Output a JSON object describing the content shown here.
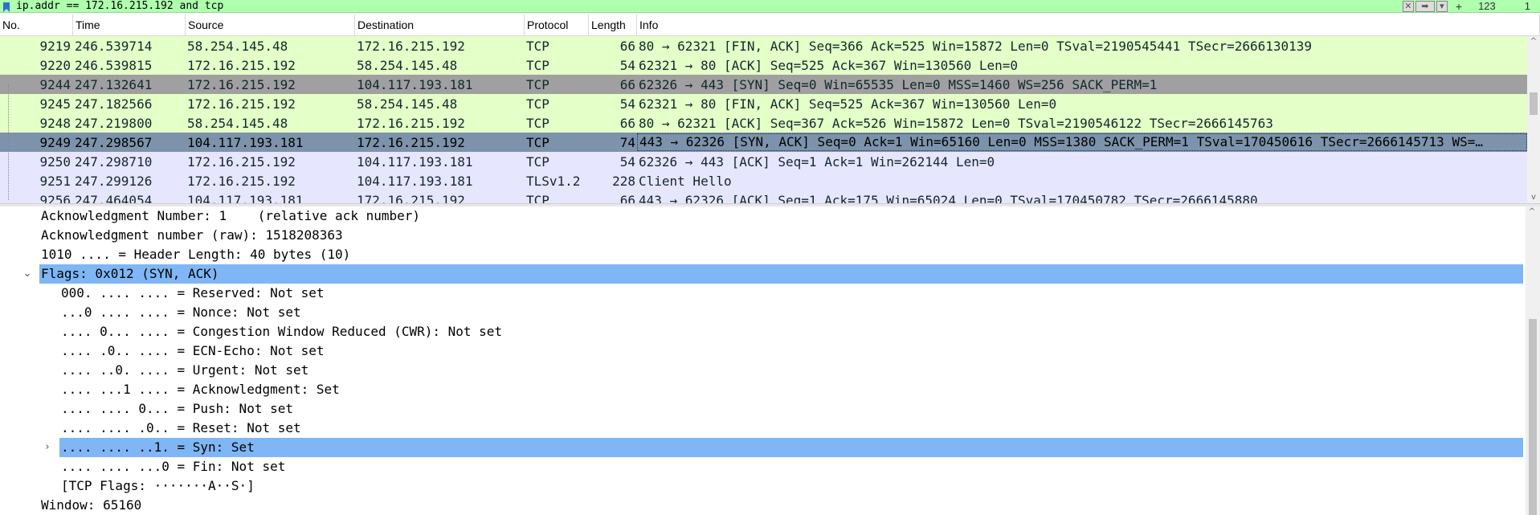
{
  "filter": {
    "text": "ip.addr == 172.16.215.192 and tcp",
    "count_a": "123",
    "count_b": "1",
    "plus": "+"
  },
  "columns": [
    "No.",
    "Time",
    "Source",
    "Destination",
    "Protocol",
    "Length",
    "Info"
  ],
  "packets": [
    {
      "no": "9219",
      "time": "246.539714",
      "src": "58.254.145.48",
      "dst": "172.16.215.192",
      "proto": "TCP",
      "len": "66",
      "info": "80 → 62321 [FIN, ACK] Seq=366 Ack=525 Win=15872 Len=0 TSval=2190545441 TSecr=2666130139",
      "bg": "#e4ffc7",
      "fg": "#12272e"
    },
    {
      "no": "9220",
      "time": "246.539815",
      "src": "172.16.215.192",
      "dst": "58.254.145.48",
      "proto": "TCP",
      "len": "54",
      "info": "62321 → 80 [ACK] Seq=525 Ack=367 Win=130560 Len=0",
      "bg": "#e4ffc7",
      "fg": "#12272e"
    },
    {
      "no": "9244",
      "time": "247.132641",
      "src": "172.16.215.192",
      "dst": "104.117.193.181",
      "proto": "TCP",
      "len": "66",
      "info": "62326 → 443 [SYN] Seq=0 Win=65535 Len=0 MSS=1460 WS=256 SACK_PERM=1",
      "bg": "#a0a0a0",
      "fg": "#12272e"
    },
    {
      "no": "9245",
      "time": "247.182566",
      "src": "172.16.215.192",
      "dst": "58.254.145.48",
      "proto": "TCP",
      "len": "54",
      "info": "62321 → 80 [FIN, ACK] Seq=525 Ack=367 Win=130560 Len=0",
      "bg": "#e4ffc7",
      "fg": "#12272e"
    },
    {
      "no": "9248",
      "time": "247.219800",
      "src": "58.254.145.48",
      "dst": "172.16.215.192",
      "proto": "TCP",
      "len": "66",
      "info": "80 → 62321 [ACK] Seq=367 Ack=526 Win=15872 Len=0 TSval=2190546122 TSecr=2666145763",
      "bg": "#e4ffc7",
      "fg": "#12272e"
    },
    {
      "no": "9249",
      "time": "247.298567",
      "src": "104.117.193.181",
      "dst": "172.16.215.192",
      "proto": "TCP",
      "len": "74",
      "info": "443 → 62326 [SYN, ACK] Seq=0 Ack=1 Win=65160 Len=0 MSS=1380 SACK_PERM=1 TSval=170450616 TSecr=2666145713 WS=…",
      "bg": "#7c93ab",
      "fg": "#000000",
      "selected": true
    },
    {
      "no": "9250",
      "time": "247.298710",
      "src": "172.16.215.192",
      "dst": "104.117.193.181",
      "proto": "TCP",
      "len": "54",
      "info": "62326 → 443 [ACK] Seq=1 Ack=1 Win=262144 Len=0",
      "bg": "#e7e6ff",
      "fg": "#12272e"
    },
    {
      "no": "9251",
      "time": "247.299126",
      "src": "172.16.215.192",
      "dst": "104.117.193.181",
      "proto": "TLSv1.2",
      "len": "228",
      "info": "Client Hello",
      "bg": "#e7e6ff",
      "fg": "#12272e"
    },
    {
      "no": "9256",
      "time": "247.464054",
      "src": "104.117.193.181",
      "dst": "172.16.215.192",
      "proto": "TCP",
      "len": "66",
      "info": "443 → 62326 [ACK] Seq=1 Ack=175 Win=65024 Len=0 TSval=170450782 TSecr=2666145880",
      "bg": "#e7e6ff",
      "fg": "#12272e"
    }
  ],
  "details": [
    {
      "text": "Acknowledgment Number: 1    (relative ack number)",
      "indent": 1
    },
    {
      "text": "Acknowledgment number (raw): 1518208363",
      "indent": 1
    },
    {
      "text": "1010 .... = Header Length: 40 bytes (10)",
      "indent": 1
    },
    {
      "text": "Flags: 0x012 (SYN, ACK)",
      "indent": 1,
      "toggle": "expanded",
      "selected": true
    },
    {
      "text": "000. .... .... = Reserved: Not set",
      "indent": 2
    },
    {
      "text": "...0 .... .... = Nonce: Not set",
      "indent": 2
    },
    {
      "text": ".... 0... .... = Congestion Window Reduced (CWR): Not set",
      "indent": 2
    },
    {
      "text": ".... .0.. .... = ECN-Echo: Not set",
      "indent": 2
    },
    {
      "text": ".... ..0. .... = Urgent: Not set",
      "indent": 2
    },
    {
      "text": ".... ...1 .... = Acknowledgment: Set",
      "indent": 2
    },
    {
      "text": ".... .... 0... = Push: Not set",
      "indent": 2
    },
    {
      "text": ".... .... .0.. = Reset: Not set",
      "indent": 2
    },
    {
      "text": ".... .... ..1. = Syn: Set",
      "indent": 2,
      "toggle": "collapsed",
      "selected": true
    },
    {
      "text": ".... .... ...0 = Fin: Not set",
      "indent": 2
    },
    {
      "text": "[TCP Flags: ·······A··S·]",
      "indent": 2
    },
    {
      "text": "Window: 65160",
      "indent": 1
    }
  ],
  "icons": {
    "filter": "bookmark-filter-icon",
    "clear": "clear-icon",
    "apply": "apply-arrow-icon",
    "dropdown": "chevron-down-icon"
  }
}
